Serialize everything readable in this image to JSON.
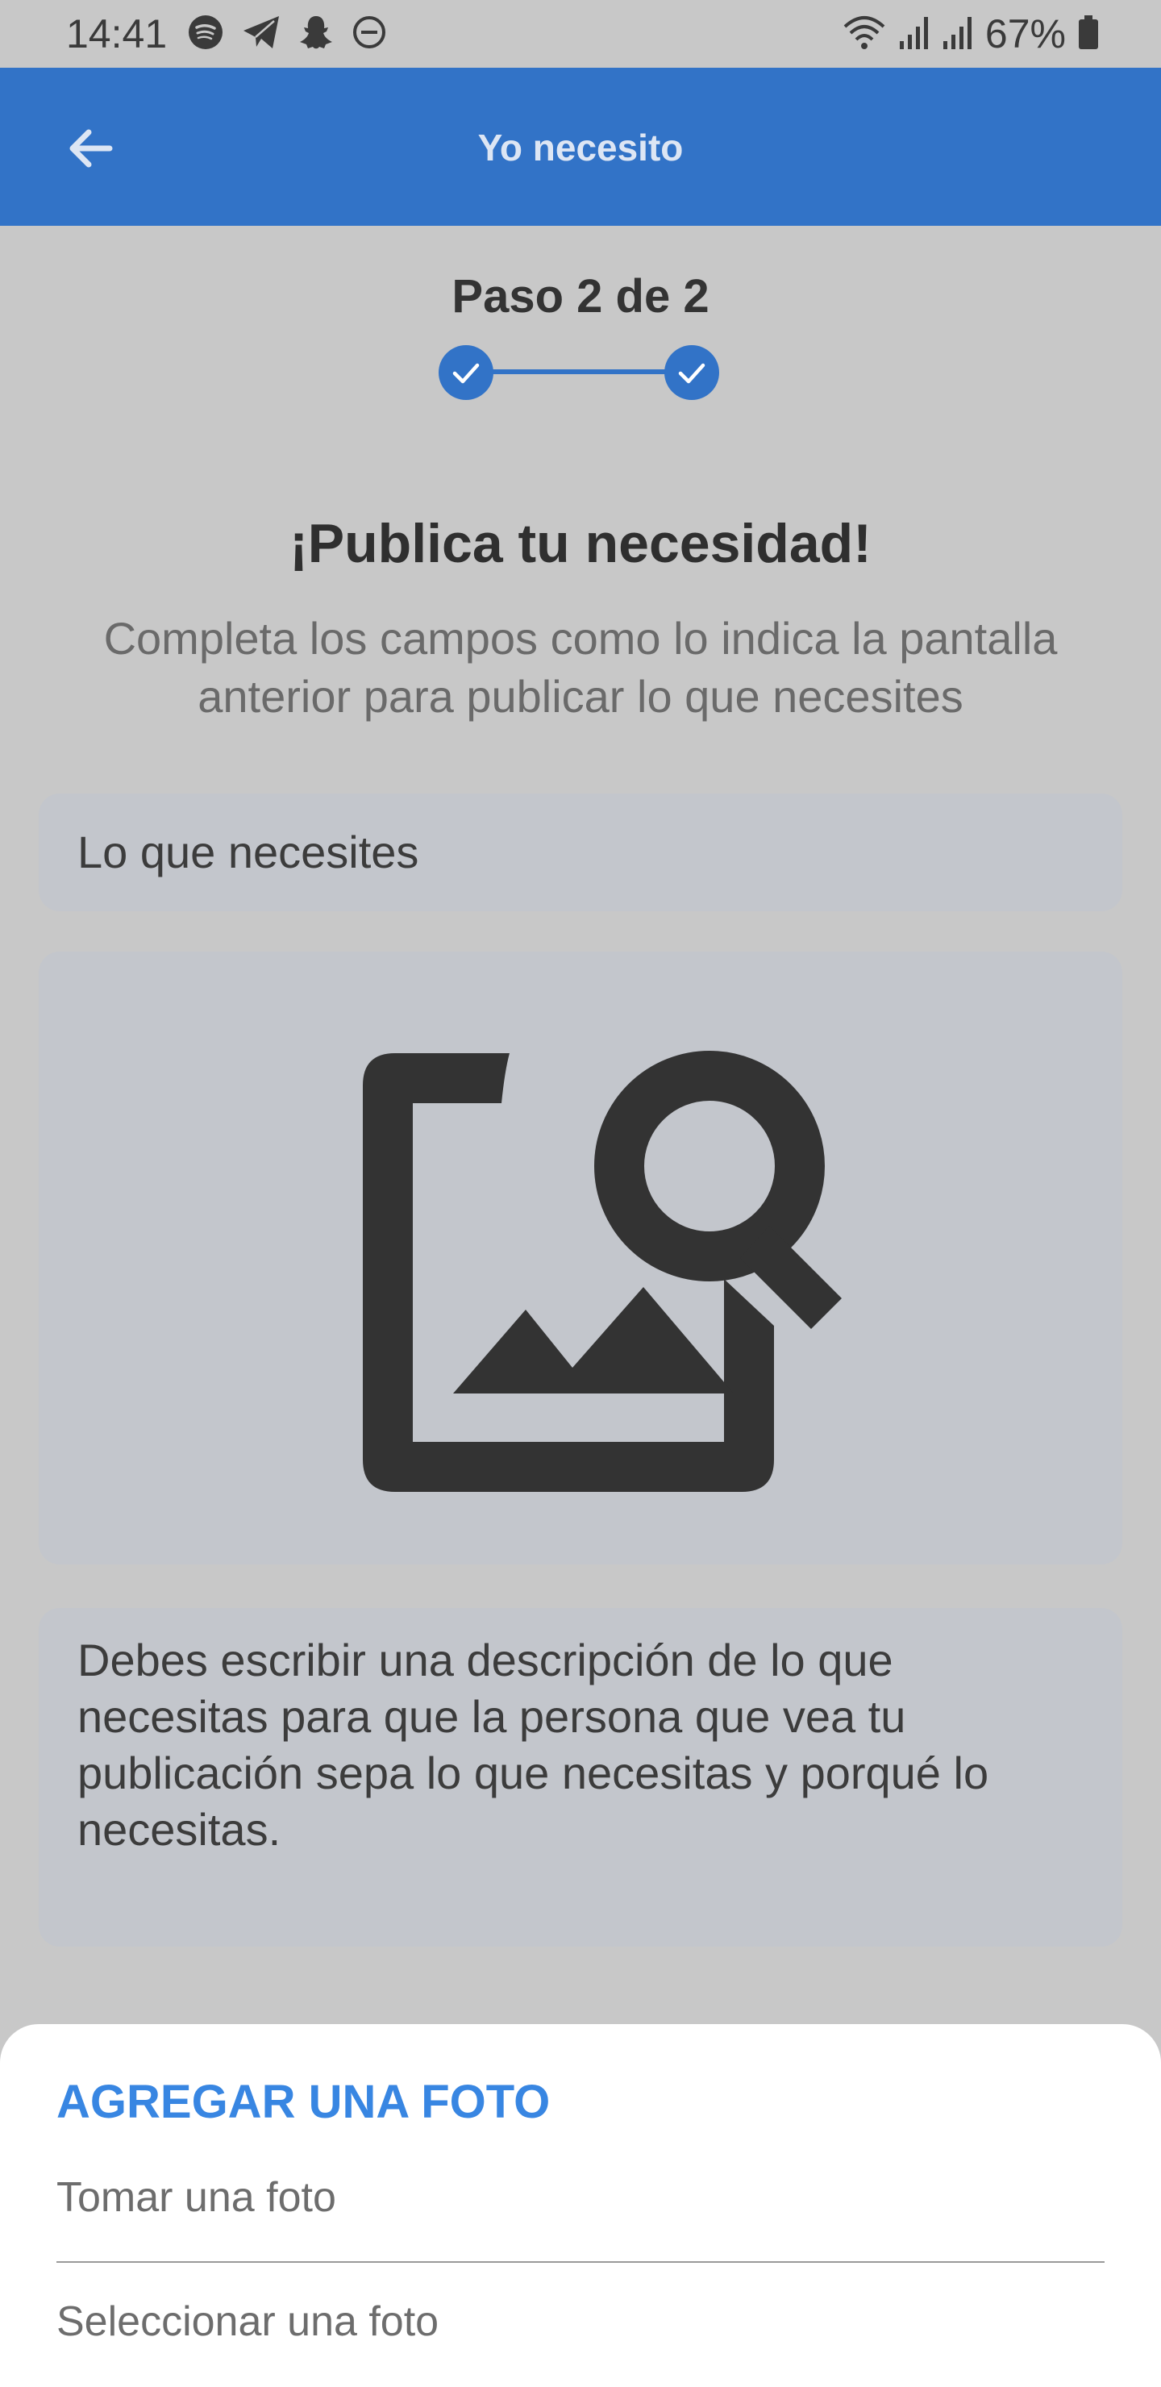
{
  "status_bar": {
    "time": "14:41",
    "left_icons": [
      "spotify-icon",
      "telegram-icon",
      "snapchat-icon",
      "do-not-disturb-icon"
    ],
    "right_icons": [
      "wifi-icon",
      "signal-icon",
      "signal-icon",
      "battery-icon"
    ],
    "battery": "67%"
  },
  "app_bar": {
    "back_icon": "arrow-left-icon",
    "title": "Yo necesito",
    "color": "#3273c7"
  },
  "stepper": {
    "label": "Paso 2 de 2",
    "steps_completed": 2,
    "steps_total": 2
  },
  "main": {
    "headline": "¡Publica tu necesidad!",
    "subtitle": "Completa los campos como lo indica la pantalla anterior para publicar lo que necesites",
    "title_field": {
      "placeholder": "Lo que necesites"
    },
    "image_field": {
      "icon": "image-search-icon"
    },
    "description_field": {
      "placeholder": "Debes escribir una descripción de lo que necesitas para que la persona que vea tu publicación sepa lo que necesitas y porqué lo necesitas."
    }
  },
  "bottom_sheet": {
    "title": "AGREGAR UNA FOTO",
    "options": [
      "Tomar una foto",
      "Seleccionar una foto"
    ],
    "accent": "#3886e2"
  }
}
